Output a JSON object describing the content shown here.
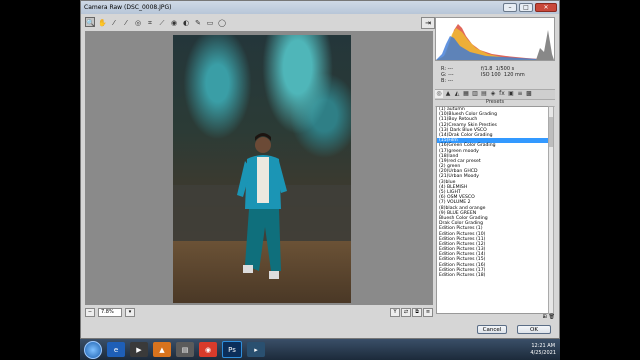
{
  "window": {
    "title": "Camera Raw (DSC_0008.JPG)",
    "min": "–",
    "max": "□",
    "close": "✕"
  },
  "toolbar": {
    "tools": [
      "zoom-icon",
      "hand-icon",
      "eyedropper-icon",
      "color-sampler-icon",
      "target-adjust-icon",
      "crop-icon",
      "straighten-icon",
      "spot-removal-icon",
      "red-eye-icon",
      "adjust-brush-icon",
      "grad-filter-icon",
      "radial-filter-icon"
    ],
    "glyphs": [
      "🔍",
      "✋",
      "⁄",
      "⁄",
      "◎",
      "⌗",
      "⟋",
      "◉",
      "◐",
      "✎",
      "▭",
      "◯"
    ],
    "right_glyph": "⇥"
  },
  "zoom": {
    "value": "7.8%"
  },
  "info": {
    "r": "R: ---",
    "g": "G: ---",
    "b": "B: ---",
    "aperture": "f/1.8",
    "shutter": "1/500 s",
    "iso": "ISO 100",
    "focal": "120 mm"
  },
  "tabs": [
    "◎",
    "▲",
    "◭",
    "▦",
    "▥",
    "▤",
    "◈",
    "fx",
    "▣",
    "≡",
    "▩"
  ],
  "presets": {
    "header": "Presets",
    "items": [
      "(1) autumn",
      "(10)Bluesh Color Grading",
      "(11)Boy Retouch",
      "(12)Creamy Skin Presties",
      "(13) Dark Blue VSCO",
      "(14)Drak Color Grading",
      "(15)Film",
      "(16)Green Color Grading",
      "(17)green moody",
      "(18)land",
      "(19)red car preset",
      "(2) green",
      "(20)Urban GHCD",
      "(21)Urban Moody",
      "(3)blue",
      "(4) BLEMISH",
      "(5) LIGHT",
      "(6) OSM VESCO",
      "(7) VOLUME 2",
      "(8)black and orange",
      "(9) BLUE GREEN",
      "Bluesh Color Grading",
      "Drak Color Grading",
      "Edition Pictures (1)",
      "Edition Pictures (10)",
      "Edition Pictures (11)",
      "Edition Pictures (12)",
      "Edition Pictures (13)",
      "Edition Pictures (14)",
      "Edition Pictures (15)",
      "Edition Pictures (16)",
      "Edition Pictures (17)",
      "Edition Pictures (18)"
    ],
    "selected_index": 6
  },
  "buttons": {
    "cancel": "Cancel",
    "ok": "OK"
  },
  "taskbar": {
    "time": "12:21 AM",
    "date": "4/25/2021"
  }
}
